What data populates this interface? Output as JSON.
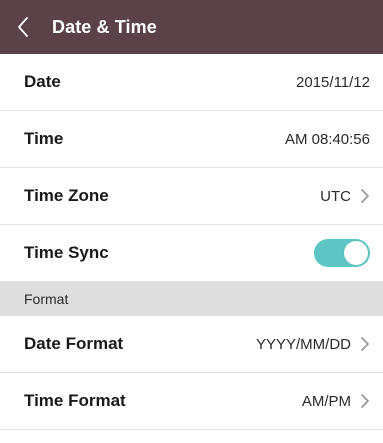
{
  "header": {
    "title": "Date & Time",
    "back_icon": "chevron-left-icon"
  },
  "rows": {
    "date": {
      "label": "Date",
      "value": "2015/11/12"
    },
    "time": {
      "label": "Time",
      "value": "AM 08:40:56"
    },
    "time_zone": {
      "label": "Time Zone",
      "value": "UTC"
    },
    "time_sync": {
      "label": "Time Sync",
      "enabled": true
    }
  },
  "section": {
    "format_title": "Format"
  },
  "format_rows": {
    "date_format": {
      "label": "Date Format",
      "value": "YYYY/MM/DD"
    },
    "time_format": {
      "label": "Time Format",
      "value": "AM/PM"
    }
  },
  "colors": {
    "header_bg": "#5b4249",
    "toggle_on": "#5dc6c5",
    "section_bg": "#dedede"
  }
}
